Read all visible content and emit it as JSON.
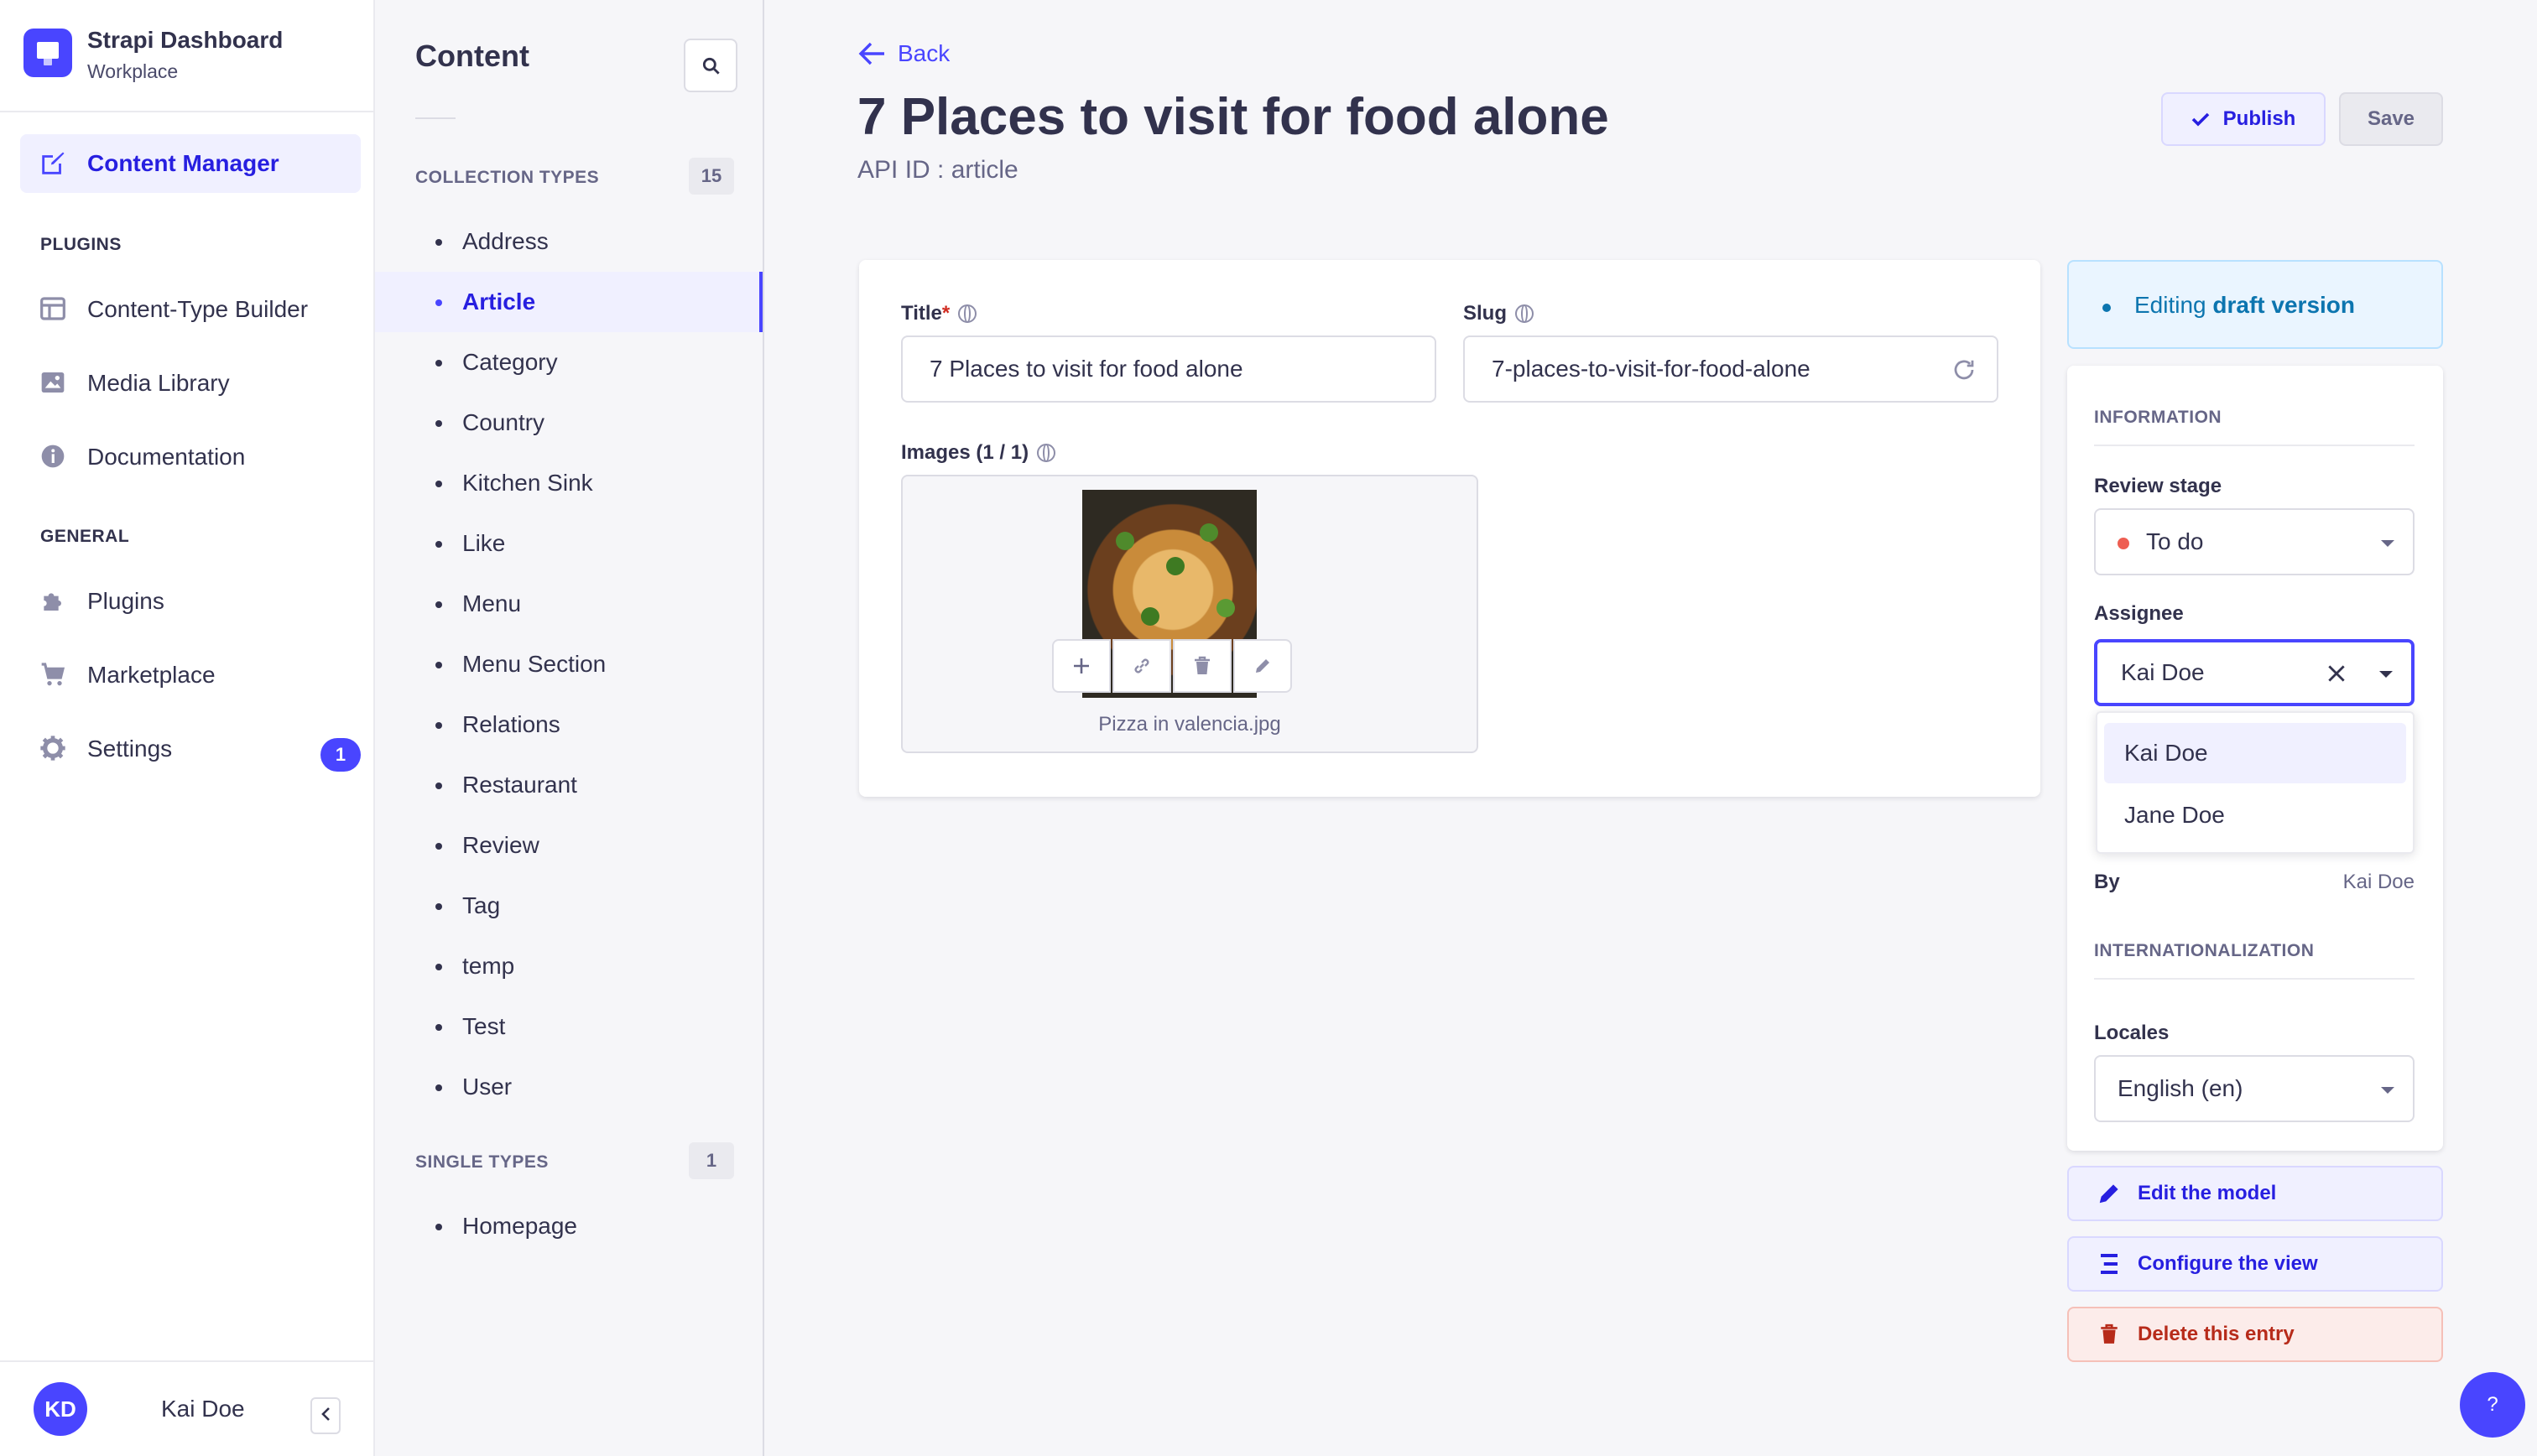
{
  "brand": {
    "title": "Strapi Dashboard",
    "subtitle": "Workplace"
  },
  "mainnav": {
    "content_manager": "Content Manager",
    "plugins_heading": "PLUGINS",
    "content_type_builder": "Content-Type Builder",
    "media_library": "Media Library",
    "documentation": "Documentation",
    "general_heading": "GENERAL",
    "plugins": "Plugins",
    "marketplace": "Marketplace",
    "settings": "Settings",
    "settings_badge": "1"
  },
  "user": {
    "initials": "KD",
    "name": "Kai Doe"
  },
  "subnav": {
    "title": "Content",
    "collection_heading": "COLLECTION TYPES",
    "collection_count": "15",
    "collection_items": [
      "Address",
      "Article",
      "Category",
      "Country",
      "Kitchen Sink",
      "Like",
      "Menu",
      "Menu Section",
      "Relations",
      "Restaurant",
      "Review",
      "Tag",
      "temp",
      "Test",
      "User"
    ],
    "single_heading": "SINGLE TYPES",
    "single_count": "1",
    "single_items": [
      "Homepage"
    ]
  },
  "header": {
    "back": "Back",
    "title": "7 Places to visit for food alone",
    "api_id": "API ID : article",
    "publish": "Publish",
    "save": "Save"
  },
  "form": {
    "title_label": "Title",
    "title_required": "*",
    "title_value": "7 Places to visit for food alone",
    "slug_label": "Slug",
    "slug_value": "7-places-to-visit-for-food-alone",
    "images_label": "Images (1 / 1)",
    "image_caption": "Pizza in valencia.jpg"
  },
  "panel": {
    "draft_prefix": "Editing ",
    "draft_strong": "draft version",
    "information": "INFORMATION",
    "review_stage_label": "Review stage",
    "review_stage_value": "To do",
    "assignee_label": "Assignee",
    "assignee_value": "Kai Doe",
    "assignee_options": [
      "Kai Doe",
      "Jane Doe"
    ],
    "by_label": "By",
    "by_value": "Kai Doe",
    "i18n": "INTERNATIONALIZATION",
    "locales_label": "Locales",
    "locales_value": "English (en)"
  },
  "actions": {
    "edit_model": "Edit the model",
    "configure_view": "Configure the view",
    "delete_entry": "Delete this entry"
  },
  "help": "?",
  "colors": {
    "primary": "#4945ff",
    "danger": "#d02b20",
    "stage_todo": "#ee5e52"
  }
}
